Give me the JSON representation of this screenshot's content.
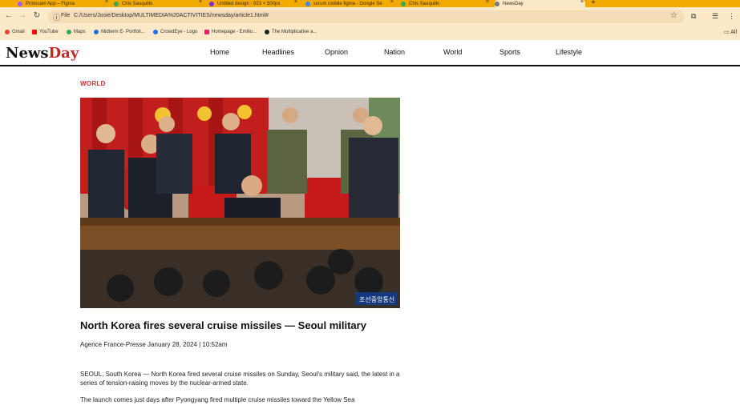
{
  "browser": {
    "tabs": [
      {
        "label": "Protocam App – Figma",
        "favicon_color": "#a259ff"
      },
      {
        "label": "Chis Sauquillo",
        "favicon_color": "#34a853"
      },
      {
        "label": "Untitled design - 923 × 500px",
        "favicon_color": "#7d2ae8"
      },
      {
        "label": "scrum mobile figma - Google Se",
        "favicon_color": "#4285f4"
      },
      {
        "label": "Chis Sauquillo",
        "favicon_color": "#34a853"
      },
      {
        "label": "NewsDay",
        "favicon_color": "#777777",
        "active": true
      }
    ],
    "omnibox": {
      "info_label": "File",
      "url": "C:/Users/Josie/Desktop/MULTIMEDIA%20ACTIVITIES/newsday/article1.html#"
    },
    "bookmarks": [
      {
        "label": "Gmail",
        "color": "#ea4335"
      },
      {
        "label": "YouTube",
        "color": "#ff0000"
      },
      {
        "label": "Maps",
        "color": "#34a853"
      },
      {
        "label": "Midterm E- Portfoli...",
        "color": "#1a73e8"
      },
      {
        "label": "CrowdEye - Logo",
        "color": "#1a73e8"
      },
      {
        "label": "Homepage - Emilio...",
        "color": "#e91e63"
      },
      {
        "label": "The Multiplicative a...",
        "color": "#202124"
      }
    ],
    "all_bookmarks_label": "All"
  },
  "site": {
    "logo": {
      "part1": "News",
      "part2": "Day"
    },
    "nav": [
      "Home",
      "Headlines",
      "Opnion",
      "Nation",
      "World",
      "Sports",
      "Lifestyle"
    ]
  },
  "article": {
    "section": "WORLD",
    "image_watermark": "조선중앙통신",
    "headline": "North Korea fires several cruise missiles — Seoul military",
    "byline": "Agence France-Presse January 28, 2024 | 10:52am",
    "paragraphs": [
      "SEOUL, South Korea — North Korea fired several cruise missiles on Sunday, Seoul's military said, the latest in a series of tension-raising moves by the nuclear-armed state.",
      "The launch comes just days after Pyongyang fired multiple cruise missiles toward the Yellow Sea"
    ]
  },
  "colors": {
    "chrome_tabstrip": "#f2a900",
    "chrome_toolbar": "#fbe9c8",
    "logo_accent": "#c62828",
    "section_label": "#d32f2f"
  }
}
